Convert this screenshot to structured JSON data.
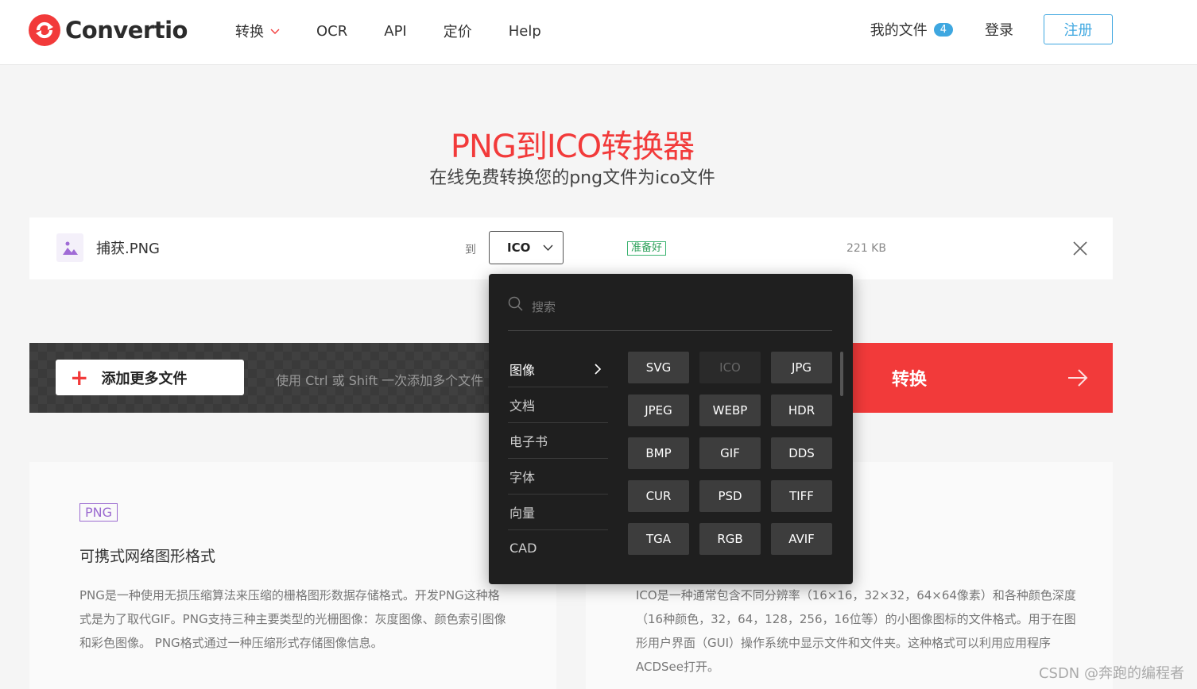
{
  "header": {
    "brand": "Convertio",
    "nav": [
      "转换",
      "OCR",
      "API",
      "定价",
      "Help"
    ],
    "my_files": "我的文件",
    "my_files_count": "4",
    "login": "登录",
    "signup": "注册"
  },
  "hero": {
    "title": "PNG到ICO转换器",
    "subtitle": "在线免费转换您的png文件为ico文件"
  },
  "file": {
    "name": "捕获.PNG",
    "to_label": "到",
    "format": "ICO",
    "status": "准备好",
    "size": "221 KB"
  },
  "actions": {
    "add_more": "添加更多文件",
    "hint": "使用 Ctrl 或 Shift 一次添加多个文件",
    "convert": "转换"
  },
  "dropdown": {
    "search_placeholder": "搜索",
    "categories": [
      "图像",
      "文档",
      "电子书",
      "字体",
      "向量",
      "CAD"
    ],
    "active_category": "图像",
    "formats": [
      "SVG",
      "ICO",
      "JPG",
      "JPEG",
      "WEBP",
      "HDR",
      "BMP",
      "GIF",
      "DDS",
      "CUR",
      "PSD",
      "TIFF",
      "TGA",
      "RGB",
      "AVIF"
    ],
    "disabled_format": "ICO"
  },
  "info": {
    "left": {
      "tag": "PNG",
      "heading": "可携式网络图形格式",
      "text": "PNG是一种使用无损压缩算法来压缩的栅格图形数据存储格式。开发PNG这种格式是为了取代GIF。PNG支持三种主要类型的光栅图像：灰度图像、颜色索引图像和彩色图像。 PNG格式通过一种压缩形式存储图像信息。"
    },
    "right": {
      "text": "ICO是一种通常包含不同分辨率（16×16，32×32，64×64像素）和各种颜色深度（16种颜色，32，64，128，256，16位等）的小图像图标的文件格式。用于在图形用户界面（GUI）操作系统中显示文件和文件夹。这种格式可以利用应用程序ACDSee打开。"
    }
  },
  "watermark": "CSDN @奔跑的编程者",
  "colors": {
    "brand_red": "#f23a3a",
    "accent_blue": "#3ea7e0",
    "ready_green": "#2da05a"
  }
}
